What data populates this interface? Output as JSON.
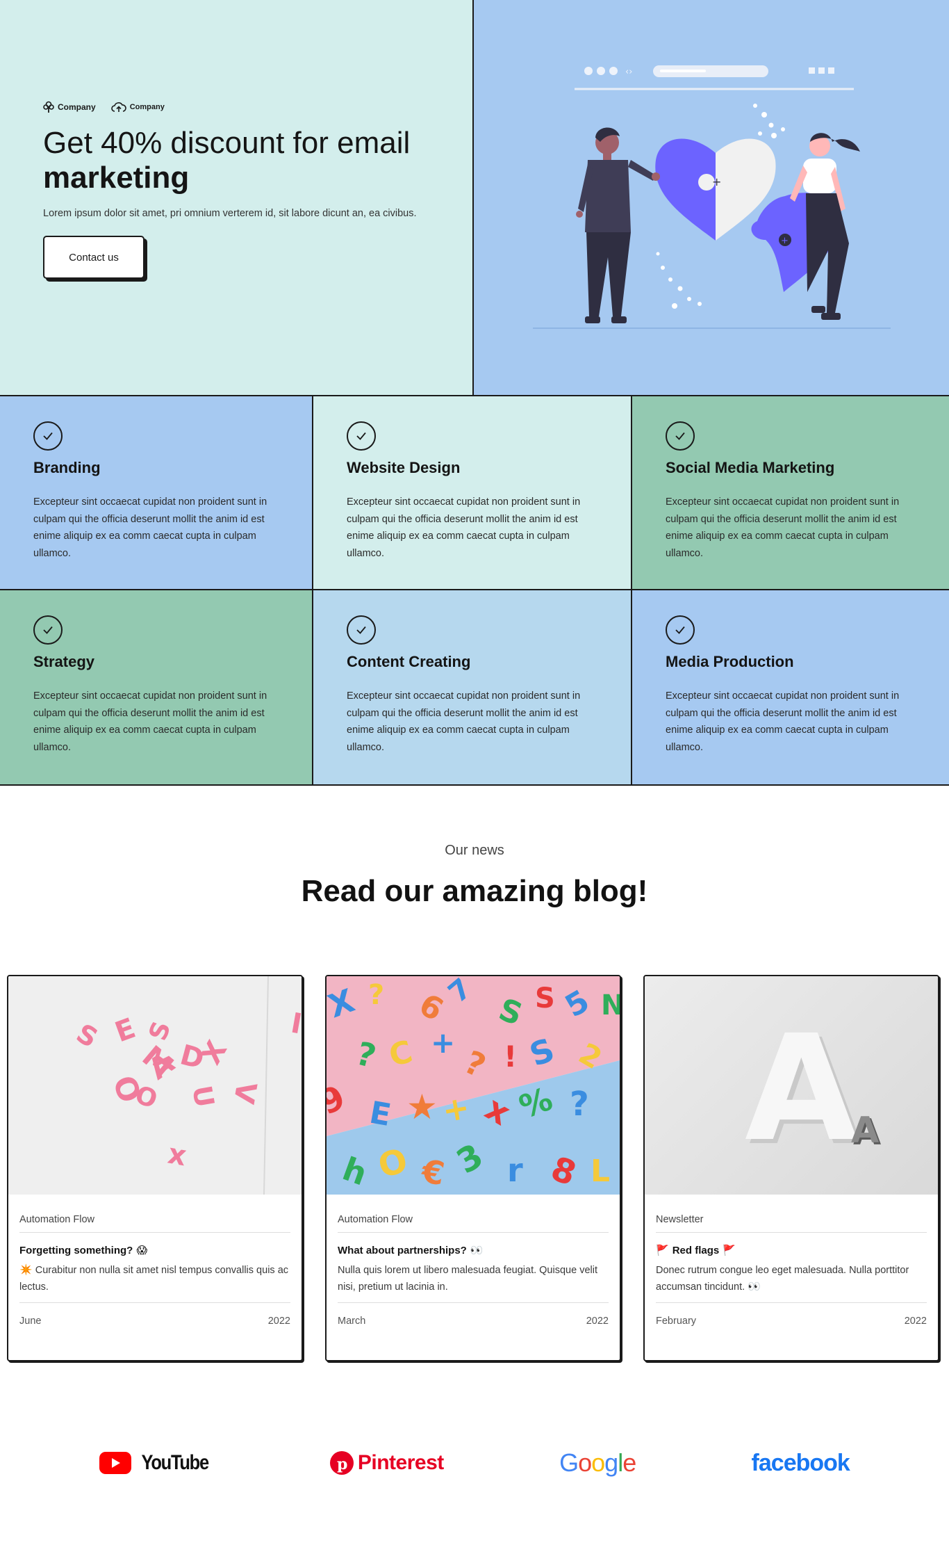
{
  "hero": {
    "logos": [
      "Company",
      "Company"
    ],
    "title_line1": "Get 40% discount for email",
    "title_line2": "marketing",
    "text": "Lorem ipsum dolor sit amet, pri omnium verterem id, sit labore dicunt an, ea civibus.",
    "button_label": "Contact us",
    "bg_left": "#d3eeec",
    "bg_right": "#a6c9f1"
  },
  "services": [
    {
      "title": "Branding",
      "text": "Excepteur sint occaecat cupidat non proident sunt in culpam qui the officia deserunt mollit the anim id est enime aliquip ex ea comm caecat cupta in culpam ullamco.",
      "bg": "#a6c9f1"
    },
    {
      "title": "Website Design",
      "text": "Excepteur sint occaecat cupidat non proident sunt in culpam qui the officia deserunt mollit the anim id est enime aliquip ex ea comm caecat cupta in culpam ullamco.",
      "bg": "#d3eeec"
    },
    {
      "title": "Social Media Marketing",
      "text": "Excepteur sint occaecat cupidat non proident sunt in culpam qui the officia deserunt mollit the anim id est enime aliquip ex ea comm caecat cupta in culpam ullamco.",
      "bg": "#93c9b1"
    },
    {
      "title": "Strategy",
      "text": "Excepteur sint occaecat cupidat non proident sunt in culpam qui the officia deserunt mollit the anim id est enime aliquip ex ea comm caecat cupta in culpam ullamco.",
      "bg": "#93c9b1"
    },
    {
      "title": "Content Creating",
      "text": "Excepteur sint occaecat cupidat non proident sunt in culpam qui the officia deserunt mollit the anim id est enime aliquip ex ea comm caecat cupta in culpam ullamco.",
      "bg": "#b6d8ee"
    },
    {
      "title": "Media Production",
      "text": "Excepteur sint occaecat cupidat non proident sunt in culpam qui the officia deserunt mollit the anim id est enime aliquip ex ea comm caecat cupta in culpam ullamco.",
      "bg": "#a6c9f1"
    }
  ],
  "blog": {
    "eyebrow": "Our news",
    "title": "Read our amazing blog!",
    "cards": [
      {
        "category": "Automation Flow",
        "title": "Forgetting something?",
        "title_emoji": "😱",
        "text_emoji": "✴️",
        "text": "Curabitur non nulla sit amet nisl tempus convallis quis ac lectus.",
        "month": "June",
        "year": "2022"
      },
      {
        "category": "Automation Flow",
        "title": "What about partnerships?",
        "title_emoji": "👀",
        "text_emoji": "",
        "text": "Nulla quis lorem ut libero malesuada feugiat. Quisque velit nisi, pretium ut lacinia in.",
        "month": "March",
        "year": "2022"
      },
      {
        "category": "Newsletter",
        "title": "Red flags",
        "title_emoji": "🚩",
        "text_emoji": "👀",
        "text": "Donec rutrum congue leo eget malesuada. Nulla porttitor accumsan tincidunt.",
        "month": "February",
        "year": "2022"
      }
    ]
  },
  "brands": {
    "youtube": "YouTube",
    "pinterest": "Pinterest",
    "google": [
      "G",
      "o",
      "o",
      "g",
      "l",
      "e"
    ],
    "facebook": "facebook"
  }
}
